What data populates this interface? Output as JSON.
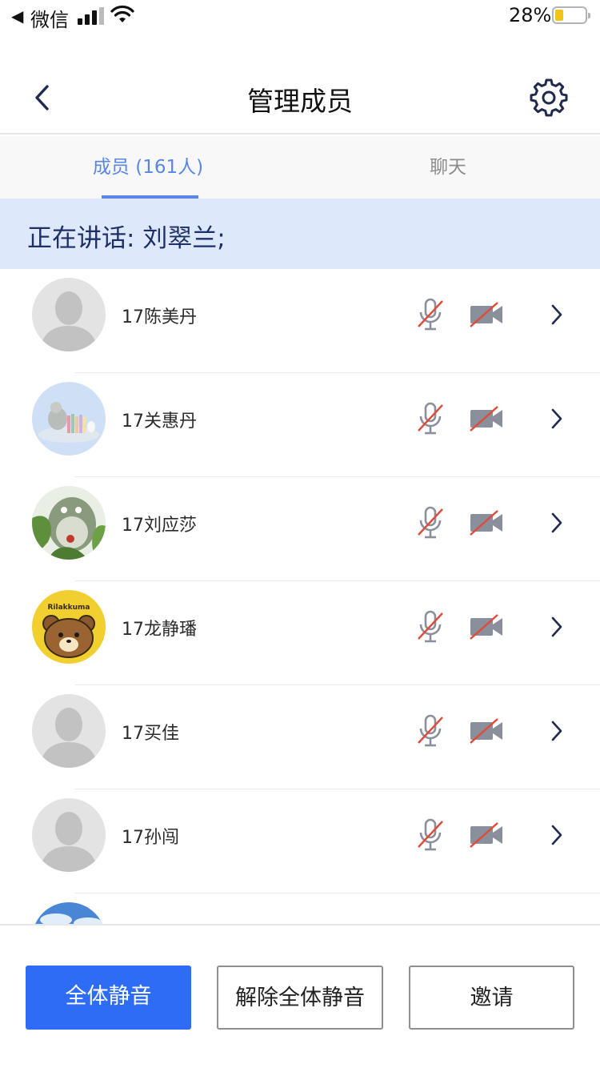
{
  "status_bar": {
    "back_app": "微信",
    "battery_percent": "28%",
    "battery_level": 0.28
  },
  "nav": {
    "title": "管理成员"
  },
  "tabs": [
    {
      "label": "成员 (161人)",
      "active": true
    },
    {
      "label": "聊天",
      "active": false
    }
  ],
  "speaking": {
    "text": "正在讲话: 刘翠兰;"
  },
  "members": [
    {
      "name": "17陈美丹",
      "avatar": "default-avatar-icon",
      "mic_muted": true,
      "camera_off": true
    },
    {
      "name": "17关惠丹",
      "avatar": "illustration-avatar",
      "mic_muted": true,
      "camera_off": true
    },
    {
      "name": "17刘应莎",
      "avatar": "totoro-avatar",
      "mic_muted": true,
      "camera_off": true
    },
    {
      "name": "17龙静璠",
      "avatar": "rilakkuma-avatar",
      "avatar_text": "Rilakkuma",
      "mic_muted": true,
      "camera_off": true
    },
    {
      "name": "17买佳",
      "avatar": "default-avatar-icon",
      "mic_muted": true,
      "camera_off": true
    },
    {
      "name": "17孙闯",
      "avatar": "default-avatar-icon",
      "mic_muted": true,
      "camera_off": true
    }
  ],
  "buttons": {
    "mute_all": "全体静音",
    "unmute_all": "解除全体静音",
    "invite": "邀请"
  },
  "colors": {
    "accent": "#2f6cf5",
    "tab_active": "#5a86e8",
    "banner_bg": "#dde8fb",
    "muted_slash": "#e04a3a"
  }
}
